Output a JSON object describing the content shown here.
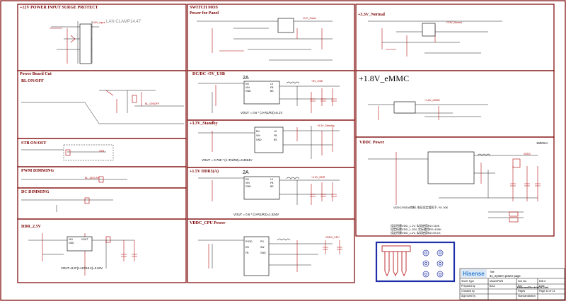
{
  "sections": {
    "surge": "+12V POWER INPUT SURGE PROTECT",
    "switch_mos": "SWITCH MOS",
    "power_for_panel": "Power for Panel",
    "normal33": "+3.3V_Normal",
    "board_cut": "Power Board Cut",
    "bl_onoff": "BL ON/OFF",
    "dcdc5v": "DC/DC +5V_USB",
    "emmc18": "+1.8V_eMMC",
    "standby33": "+3.3V_Standby",
    "stb_onoff": "STB ON/OFF",
    "vddc_power": "VDDC Power",
    "pwm_dimming": "PWM DIMMING",
    "ddr15": "+1.5V DDR3(A)",
    "dc_dimming": "DC DIMMING",
    "ddr25": "DDR_2.5V",
    "vddc_cpu": "VDDC_CPU Power"
  },
  "currents": {
    "usb": "2A",
    "ddr": "2A"
  },
  "formulas": {
    "usb": "VOUT = 0.6 * (1+R1/R2)=5.1V",
    "standby": "VOUT = 0.768 * (1+R1/R2)=3.3024V",
    "ddr": "VOUT = 0.6 * (1+R1/R2)=1.534V",
    "ddr25": "VOUT=0.8*(1+22/10.2)=2.52V"
  },
  "chips": {
    "usb": [
      "EN",
      "LX",
      "VIN",
      "FB",
      "GND",
      "BS"
    ],
    "standby": [
      "EN",
      "LX",
      "VIN",
      "FB",
      "GND",
      "BS"
    ],
    "ddr": [
      "EN",
      "LX",
      "VIN",
      "FB",
      "GND",
      "BS"
    ],
    "cpu": [
      "PVDD",
      "EN",
      "FB",
      "PG",
      "SW",
      "GND"
    ],
    "regulator_small": [
      "VIN",
      "VOUT",
      "GND"
    ]
  },
  "nets": {
    "stb": "STB",
    "bl_adj": "BL_ADJUST",
    "v5_usb": "+5V_USB",
    "v33_standby": "+3.3V_Standby",
    "v33_normal": "+3.3V_Normal",
    "v18_emmc": "+1.8V_eMMC",
    "v12": "+12V_Input",
    "vddc": "VDDC",
    "ddr15": "+1.5V_DDR",
    "bl_on": "BL_ON/OFF",
    "vcc_panel": "VCC_Panel",
    "vddc_cpu": "VDDC_CPU"
  },
  "vddc_note": "VDDC/VDDA控制, 电压设定值如下, R1 30K",
  "vddc_settings": [
    "设定所需VDD_1.1V, 实际使用R2=110K",
    "设定所需VDD_1.15V, 实际使用R2=100K",
    "设定所需VDD_1.2V, 实际使用R2=93.1K"
  ],
  "vddc_label": "1500mA",
  "clamp_text": "LAN CLAMP14.47",
  "title_block": {
    "brand": "Hisense",
    "company": "HisenseElectricCo.,Ltd.",
    "title_label": "Title",
    "title_value": "3x_System power page",
    "rows": [
      [
        "Sheet Type",
        "Model/PWB",
        "Sch No.",
        "Edit #"
      ],
      [
        "Prepared by",
        "BOA",
        "Rev",
        "Date"
      ],
      [
        "Checked by",
        "",
        "Pages",
        "Page 10 of 14"
      ],
      [
        "Approved by",
        "",
        "Standardization",
        ""
      ]
    ]
  },
  "colors": {
    "border": "#7a0000",
    "wire": "#1a1a1a",
    "component": "#b00000",
    "highlight_box": "#1f2fa8",
    "chip_fill": "#ffffff"
  }
}
